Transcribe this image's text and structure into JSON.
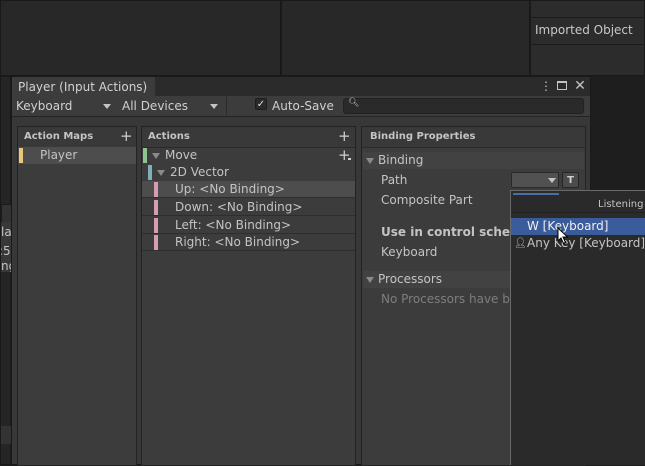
{
  "background": {
    "imported_object_label": "Imported Object",
    "left_fragments": [
      "la",
      ":5",
      "ng"
    ]
  },
  "window": {
    "title": "Player (Input Actions)",
    "icons": [
      "more-vert-icon",
      "maximize-icon",
      "close-icon"
    ],
    "toolbar": {
      "control_scheme": "Keyboard",
      "devices": "All Devices",
      "auto_save_label": "Auto-Save",
      "auto_save_checked": true,
      "search_value": ""
    },
    "action_maps": {
      "header": "Action Maps",
      "items": [
        {
          "label": "Player",
          "color": "#e8c97b",
          "selected": true
        }
      ]
    },
    "actions": {
      "header": "Actions",
      "action": {
        "label": "Move",
        "color": "#8fc48f"
      },
      "composite": {
        "label": "2D Vector",
        "color": "#7fb0b8"
      },
      "bindings": [
        {
          "label": "Up: <No Binding>",
          "selected": true
        },
        {
          "label": "Down: <No Binding>",
          "selected": false
        },
        {
          "label": "Left: <No Binding>",
          "selected": false
        },
        {
          "label": "Right: <No Binding>",
          "selected": false
        }
      ],
      "binding_color": "#d79bb4"
    },
    "binding_properties": {
      "header": "Binding Properties",
      "binding_section": "Binding",
      "path_label": "Path",
      "t_button": "T",
      "composite_part_label": "Composite Part",
      "use_in_scheme_label": "Use in control scheme",
      "scheme_keyboard": "Keyboard",
      "processors_section": "Processors",
      "no_processors_text": "No Processors have bee"
    }
  },
  "dropdown": {
    "listening_text": "Listening f",
    "items": [
      {
        "label": "W [Keyboard]",
        "highlighted": true
      },
      {
        "label": "Any Key [Keyboard]",
        "highlighted": false
      }
    ]
  }
}
